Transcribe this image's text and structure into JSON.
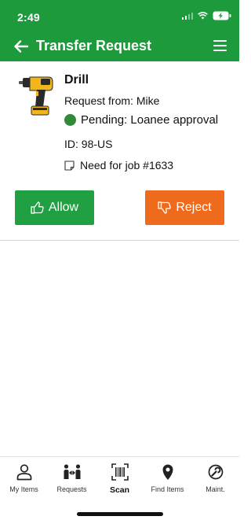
{
  "status_bar": {
    "time": "2:49"
  },
  "app_bar": {
    "title": "Transfer Request"
  },
  "request": {
    "item_name": "Drill",
    "request_from": "Request from: Mike",
    "status": "Pending: Loanee approval",
    "status_color": "#2f8a3a",
    "id": "ID: 98-US",
    "note": "Need for job #1633"
  },
  "actions": {
    "allow_label": "Allow",
    "reject_label": "Reject",
    "allow_color": "#21a043",
    "reject_color": "#ef6a1b"
  },
  "tabs": [
    {
      "label": "My Items",
      "icon": "person-icon"
    },
    {
      "label": "Requests",
      "icon": "transfer-people-icon"
    },
    {
      "label": "Scan",
      "icon": "barcode-scan-icon",
      "active": true
    },
    {
      "label": "Find Items",
      "icon": "map-pin-icon"
    },
    {
      "label": "Maint.",
      "icon": "maintenance-icon"
    }
  ],
  "brand_color": "#1d9a3c"
}
